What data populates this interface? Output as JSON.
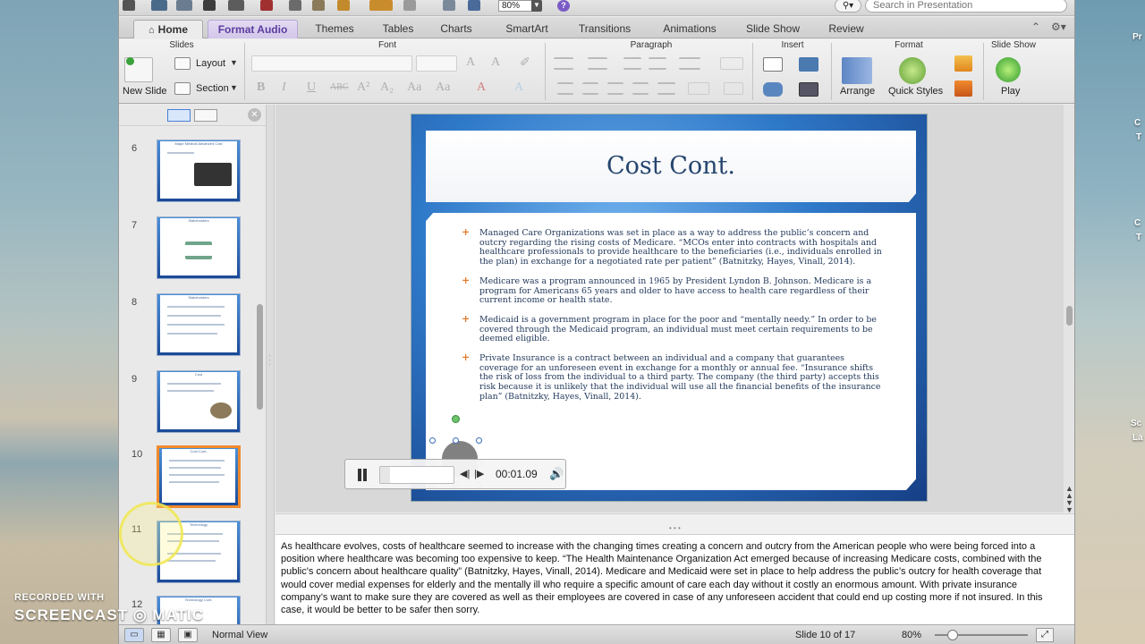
{
  "app": {
    "zoom": "80%",
    "search_placeholder": "Search in Presentation"
  },
  "tabs": [
    {
      "label": "Home"
    },
    {
      "label": "Format Audio"
    },
    {
      "label": "Themes"
    },
    {
      "label": "Tables"
    },
    {
      "label": "Charts"
    },
    {
      "label": "SmartArt"
    },
    {
      "label": "Transitions"
    },
    {
      "label": "Animations"
    },
    {
      "label": "Slide Show"
    },
    {
      "label": "Review"
    }
  ],
  "ribbon": {
    "groups": {
      "slides": "Slides",
      "font": "Font",
      "paragraph": "Paragraph",
      "insert": "Insert",
      "format": "Format",
      "slide_show": "Slide Show"
    },
    "new_slide": "New Slide",
    "layout": "Layout",
    "section": "Section",
    "arrange": "Arrange",
    "quick_styles": "Quick Styles",
    "play": "Play"
  },
  "thumbnails": [
    {
      "num": "6",
      "title": "Major Medical Advanced Cost"
    },
    {
      "num": "7",
      "title": "Stakeholders"
    },
    {
      "num": "8",
      "title": "Stakeholders"
    },
    {
      "num": "9",
      "title": "Cost"
    },
    {
      "num": "10",
      "title": "Cost Cont."
    },
    {
      "num": "11",
      "title": "Technology"
    },
    {
      "num": "12",
      "title": "Technology Cont."
    }
  ],
  "slide": {
    "title": "Cost Cont.",
    "bullets": [
      "Managed Care Organizations was set in place as a way to address the public’s concern and outcry regarding the rising costs of Medicare. “MCOs enter into contracts with hospitals and healthcare professionals to provide healthcare to the beneficiaries (i.e., individuals enrolled in the plan) in exchange for a negotiated rate per patient” (Batnitzky, Hayes, Vinall, 2014).",
      "Medicare was a program announced in 1965 by President Lyndon B. Johnson. Medicare is a program for Americans 65 years and older to have access to health care regardless of their current income or health state.",
      "Medicaid is a government program in place for the poor and “mentally needy.” In order to be covered through the Medicaid program, an individual must meet certain requirements to be deemed eligible.",
      "Private Insurance is a contract between an individual and a company that guarantees coverage for an unforeseen event  in exchange for a monthly or annual fee. “Insurance shifts the risk of loss from the individual to a third party. The company (the third party) accepts this risk because it is unlikely that the individual will use all the financial benefits of the insurance plan” (Batnitzky, Hayes, Vinall, 2014)."
    ]
  },
  "audio_player": {
    "time": "00:01.09",
    "progress_fraction": 0.14
  },
  "notes": "As healthcare evolves, costs of healthcare seemed to increase with the changing times creating a concern and outcry from the American people who were being forced into a position where healthcare was becoming too expensive to keep. “The Health Maintenance Organization Act emerged because of increasing Medicare costs, combined with the public's concern about healthcare quality” (Batnitzky, Hayes, Vinall, 2014). Medicare and Medicaid were set in place to help address the public’s outcry for health coverage that would cover medial expenses for elderly and the mentally ill who require a specific amount of care each day without it costly an enormous amount. With private insurance company’s want to make sure they are covered as well as their employees are covered in case of any unforeseen accident that could end up costing more if not insured. In this case, it would be better to be safer then sorry.",
  "status": {
    "view": "Normal View",
    "slide_counter": "Slide 10 of 17",
    "zoom": "80%"
  },
  "watermark": {
    "line1": "RECORDED WITH",
    "line2": "SCREENCAST ◎ MATIC"
  },
  "desktop_labels": [
    "Pr",
    "C",
    "T",
    "C",
    "T",
    "Sc",
    "La"
  ],
  "colors": {
    "accent_tab": "#5b3d9e",
    "slide_title": "#25456e",
    "bullet_marker": "#e07a2c",
    "selected_thumb": "#f08a2c"
  }
}
